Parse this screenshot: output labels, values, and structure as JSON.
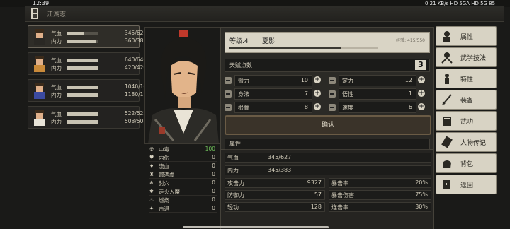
{
  "status_bar": {
    "time": "12:39",
    "right": "0.21 KB/s  HD  5GA  HD  5G  85"
  },
  "title": "江湖志",
  "party": [
    {
      "hp_label": "气血",
      "hp": "345/627",
      "hp_frac": 0.55,
      "mp_label": "内力",
      "mp": "360/383",
      "mp_frac": 0.94,
      "selected": true
    },
    {
      "hp_label": "气血",
      "hp": "640/640",
      "hp_frac": 1.0,
      "mp_label": "内力",
      "mp": "420/420",
      "mp_frac": 1.0,
      "selected": false
    },
    {
      "hp_label": "气血",
      "hp": "1040/1040",
      "hp_frac": 1.0,
      "mp_label": "内力",
      "mp": "1180/1180",
      "mp_frac": 1.0,
      "selected": false
    },
    {
      "hp_label": "气血",
      "hp": "522/522",
      "hp_frac": 1.0,
      "mp_label": "内力",
      "mp": "508/508",
      "mp_frac": 1.0,
      "selected": false
    }
  ],
  "character": {
    "level": "等级.4",
    "name": "夏影",
    "exp": "经验: 415/550",
    "exp_frac": 0.75,
    "talent_label": "天赋点数",
    "talent_points": "3",
    "stats": [
      {
        "name": "臂力",
        "value": "10"
      },
      {
        "name": "定力",
        "value": "12"
      },
      {
        "name": "身法",
        "value": "7"
      },
      {
        "name": "悟性",
        "value": "1"
      },
      {
        "name": "根骨",
        "value": "8"
      },
      {
        "name": "速度",
        "value": "6"
      }
    ],
    "confirm": "确认"
  },
  "effects": [
    {
      "icon": "☢",
      "name": "中毒",
      "value": "100",
      "highlight": true
    },
    {
      "icon": "♥",
      "name": "内伤",
      "value": "0"
    },
    {
      "icon": "♦",
      "name": "流血",
      "value": "0"
    },
    {
      "icon": "❄",
      "name": "封穴",
      "value": "0"
    },
    {
      "icon": "✱",
      "name": "走火入魔",
      "value": "0"
    },
    {
      "icon": "♨",
      "name": "燃烧",
      "value": "0"
    },
    {
      "icon": "✦",
      "name": "击退",
      "value": "0"
    }
  ],
  "effects_raw": [
    "中毒",
    "内伤",
    "流血",
    "酆酒虞",
    "封穴",
    "走火入魔",
    "燃烧",
    "击退"
  ],
  "attributes": {
    "header": "属性",
    "hp_label": "气血",
    "hp": "345/627",
    "mp_label": "内力",
    "mp": "345/383",
    "left": [
      {
        "name": "攻击力",
        "value": "9327"
      },
      {
        "name": "防御力",
        "value": "57"
      },
      {
        "name": "轻功",
        "value": "128"
      }
    ],
    "right": [
      {
        "name": "暴击率",
        "value": "20%"
      },
      {
        "name": "暴击伤害",
        "value": "75%"
      },
      {
        "name": "连击率",
        "value": "30%"
      }
    ]
  },
  "menu": [
    {
      "label": "属性",
      "icon": "person-icon"
    },
    {
      "label": "武学技法",
      "icon": "martial-arts-icon"
    },
    {
      "label": "特性",
      "icon": "trait-icon"
    },
    {
      "label": "装备",
      "icon": "sword-icon"
    },
    {
      "label": "武功",
      "icon": "book-icon"
    },
    {
      "label": "人物传记",
      "icon": "scroll-icon"
    },
    {
      "label": "背包",
      "icon": "bag-icon"
    },
    {
      "label": "返回",
      "icon": "exit-icon"
    }
  ]
}
